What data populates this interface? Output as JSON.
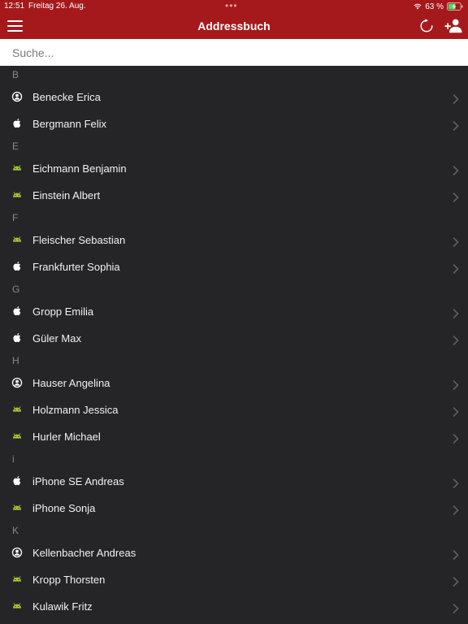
{
  "status_bar": {
    "time": "12:51",
    "date": "Freitag 26. Aug.",
    "multitask_indicator": "•••",
    "battery_percent": "63 %",
    "battery_level": 0.63,
    "battery_charging": true
  },
  "nav": {
    "title": "Addressbuch",
    "menu_icon": "hamburger-menu-icon",
    "refresh_icon": "refresh-icon",
    "add_icon": "add-contact-icon"
  },
  "search": {
    "placeholder": "Suche...",
    "value": ""
  },
  "colors": {
    "header_bg": "#a5191c",
    "list_bg": "#252528",
    "android": "#a4c639",
    "section_text": "#8a8a8e",
    "chevron": "#5e5e62"
  },
  "sections": [
    {
      "letter": "B",
      "items": [
        {
          "name": "Benecke Erica",
          "icon": "contact"
        },
        {
          "name": "Bergmann Felix",
          "icon": "apple"
        }
      ]
    },
    {
      "letter": "E",
      "items": [
        {
          "name": "Eichmann Benjamin",
          "icon": "android"
        },
        {
          "name": "Einstein Albert",
          "icon": "android"
        }
      ]
    },
    {
      "letter": "F",
      "items": [
        {
          "name": "Fleischer Sebastian",
          "icon": "android"
        },
        {
          "name": "Frankfurter Sophia",
          "icon": "apple"
        }
      ]
    },
    {
      "letter": "G",
      "items": [
        {
          "name": "Gropp Emilia",
          "icon": "apple"
        },
        {
          "name": "Güler Max",
          "icon": "apple"
        }
      ]
    },
    {
      "letter": "H",
      "items": [
        {
          "name": "Hauser Angelina",
          "icon": "contact"
        },
        {
          "name": "Holzmann Jessica",
          "icon": "android"
        },
        {
          "name": "Hurler Michael",
          "icon": "android"
        }
      ]
    },
    {
      "letter": "i",
      "items": [
        {
          "name": "iPhone SE Andreas",
          "icon": "apple"
        },
        {
          "name": "iPhone Sonja",
          "icon": "android"
        }
      ]
    },
    {
      "letter": "K",
      "items": [
        {
          "name": "Kellenbacher Andreas",
          "icon": "contact"
        },
        {
          "name": "Kropp Thorsten",
          "icon": "android"
        },
        {
          "name": "Kulawik Fritz",
          "icon": "android"
        }
      ]
    }
  ]
}
